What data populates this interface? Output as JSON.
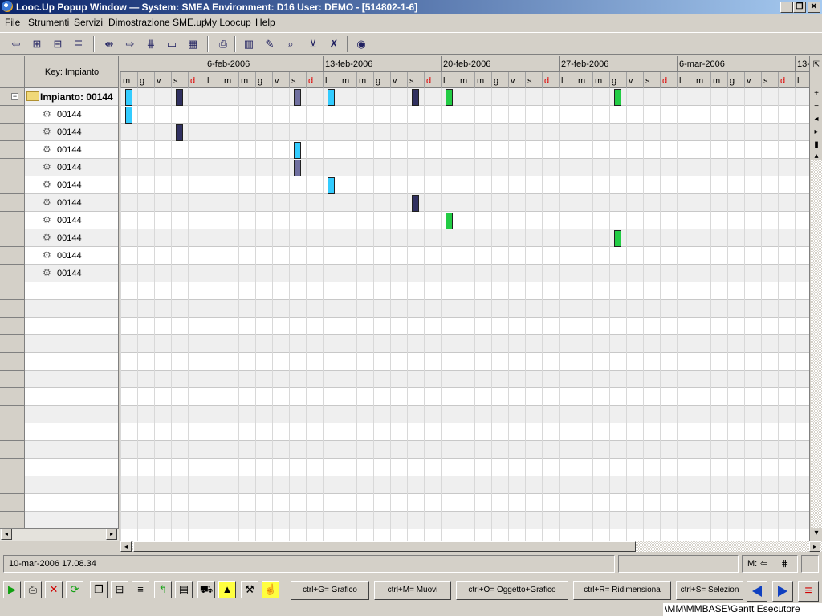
{
  "window": {
    "title": "Looc.Up Popup Window  —  System: SMEA Environment: D16 User: DEMO - [514802-1-6]"
  },
  "menu": [
    "File",
    "Strumenti",
    "Servizi",
    "Dimostrazione SME.up",
    "My Loocup",
    "Help"
  ],
  "tree": {
    "header": "Key: Impianto",
    "root_label": "Impianto: 00144",
    "children": [
      "00144",
      "00144",
      "00144",
      "00144",
      "00144",
      "00144",
      "00144",
      "00144",
      "00144",
      "00144"
    ]
  },
  "gantt": {
    "weeks": [
      "6-feb-2006",
      "13-feb-2006",
      "20-feb-2006",
      "27-feb-2006",
      "6-mar-2006",
      "13-"
    ],
    "days": [
      "m",
      "g",
      "v",
      "s",
      "d",
      "l",
      "m",
      "m",
      "g",
      "v",
      "s",
      "d",
      "l",
      "m",
      "m",
      "g",
      "v",
      "s",
      "d",
      "l",
      "m",
      "m",
      "g",
      "v",
      "s",
      "d",
      "l",
      "m",
      "m",
      "g",
      "v",
      "s",
      "d",
      "l",
      "m",
      "m",
      "g",
      "v",
      "s",
      "d",
      "l"
    ],
    "colors": {
      "cyan": "#33ccff",
      "navy": "#303060",
      "gray": "#7070a0",
      "green": "#22cc44"
    },
    "bars": [
      {
        "row": 0,
        "day": 0,
        "color": "cyan"
      },
      {
        "row": 0,
        "day": 3,
        "color": "navy"
      },
      {
        "row": 0,
        "day": 10,
        "color": "gray"
      },
      {
        "row": 0,
        "day": 12,
        "color": "cyan"
      },
      {
        "row": 0,
        "day": 17,
        "color": "navy"
      },
      {
        "row": 0,
        "day": 19,
        "color": "green"
      },
      {
        "row": 0,
        "day": 29,
        "color": "green"
      },
      {
        "row": 1,
        "day": 0,
        "color": "cyan"
      },
      {
        "row": 2,
        "day": 3,
        "color": "navy"
      },
      {
        "row": 3,
        "day": 10,
        "color": "cyan"
      },
      {
        "row": 4,
        "day": 10,
        "color": "gray"
      },
      {
        "row": 5,
        "day": 12,
        "color": "cyan"
      },
      {
        "row": 6,
        "day": 17,
        "color": "navy"
      },
      {
        "row": 7,
        "day": 19,
        "color": "green"
      },
      {
        "row": 8,
        "day": 29,
        "color": "green"
      }
    ]
  },
  "status": {
    "datetime": "10-mar-2006 17.08.34",
    "mode_label": "M:"
  },
  "shortcuts": [
    "ctrl+G= Grafico",
    "ctrl+M= Muovi",
    "ctrl+O= Oggetto+Grafico",
    "ctrl+R= Ridimensiona",
    "ctrl+S= Selezion"
  ],
  "footer": "\\MM\\MMBASE\\Gantt Esecutore"
}
